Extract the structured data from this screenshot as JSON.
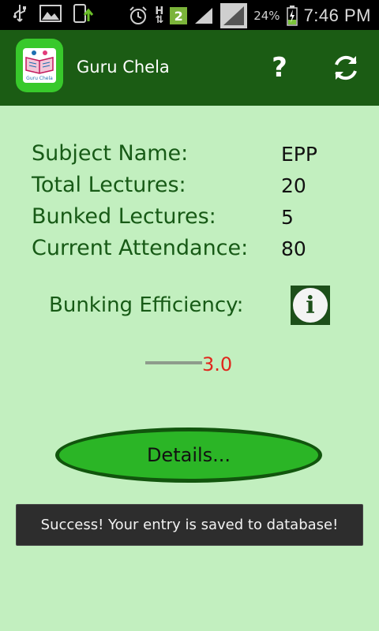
{
  "status_bar": {
    "icons_left": [
      "usb-icon",
      "image-icon",
      "phone-upload-icon"
    ],
    "icons_right": [
      "alarm-icon",
      "data-hspa-icon",
      "notification-count-icon",
      "signal-icon",
      "signal-box-icon",
      "battery-icon"
    ],
    "h_indicator": "H",
    "badge": "2",
    "battery_percent": "24%",
    "time": "7:46 PM"
  },
  "action_bar": {
    "app_title": "Guru Chela",
    "app_icon_caption": "Guru Chela",
    "background": "#1b5c14"
  },
  "info": {
    "subject_label": "Subject Name:",
    "subject_value": "EPP",
    "total_label": "Total Lectures:",
    "total_value": "20",
    "bunked_label": "Bunked Lectures:",
    "bunked_value": "5",
    "attendance_label": "Current Attendance:",
    "attendance_value": "80"
  },
  "efficiency": {
    "label": "Bunking Efficiency:",
    "info_icon": "i",
    "value": "3.0"
  },
  "details_button": {
    "label": "Details..."
  },
  "toast": {
    "message": "Success! Your entry is saved to database!"
  },
  "colors": {
    "background": "#c2efbf",
    "text_green": "#175a16",
    "button_green": "#2bb526",
    "value_red": "#e0261c"
  }
}
